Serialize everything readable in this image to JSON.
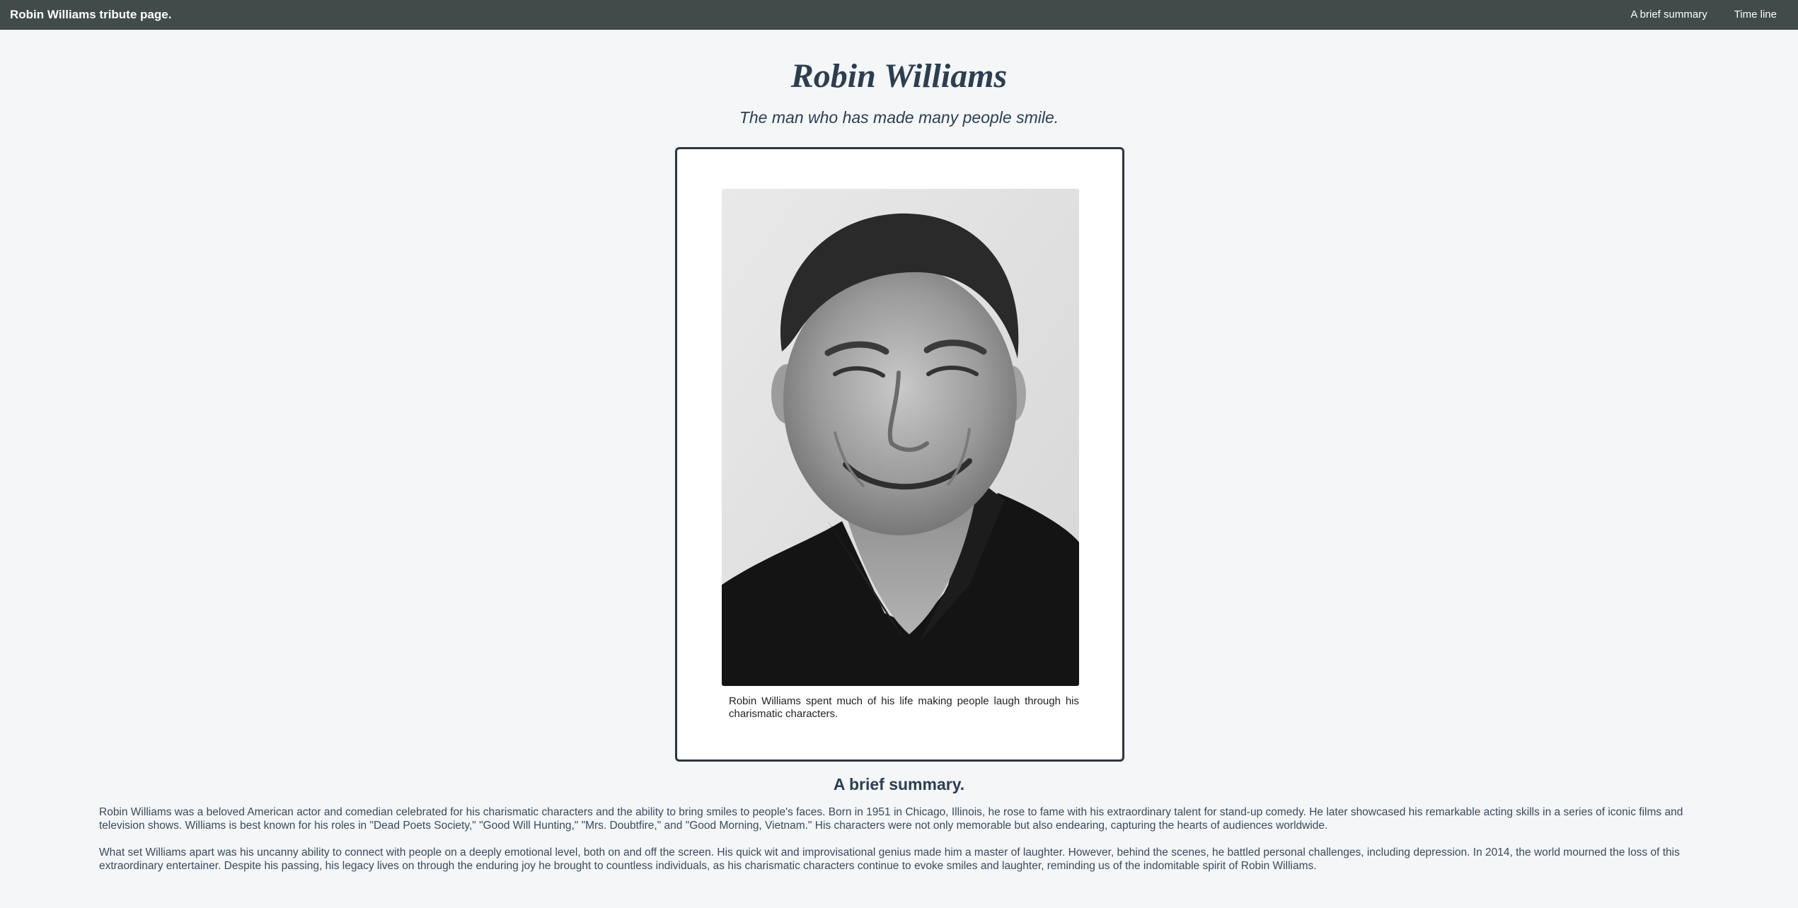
{
  "navbar": {
    "brand": "Robin Williams tribute page.",
    "links": [
      {
        "label": "A brief summary"
      },
      {
        "label": "Time line"
      }
    ]
  },
  "header": {
    "title": "Robin Williams",
    "subtitle": "The man who has made many people smile."
  },
  "figure": {
    "image": "black-and-white portrait photo",
    "caption": "Robin Williams spent much of his life making people laugh through his charismatic characters."
  },
  "summary": {
    "heading": "A brief summary.",
    "paragraphs": [
      "Robin Williams was a beloved American actor and comedian celebrated for his charismatic characters and the ability to bring smiles to people's faces. Born in 1951 in Chicago, Illinois, he rose to fame with his extraordinary talent for stand-up comedy. He later showcased his remarkable acting skills in a series of iconic films and television shows. Williams is best known for his roles in \"Dead Poets Society,\" \"Good Will Hunting,\" \"Mrs. Doubtfire,\" and \"Good Morning, Vietnam.\" His characters were not only memorable but also endearing, capturing the hearts of audiences worldwide.",
      "What set Williams apart was his uncanny ability to connect with people on a deeply emotional level, both on and off the screen. His quick wit and improvisational genius made him a master of laughter. However, behind the scenes, he battled personal challenges, including depression. In 2014, the world mourned the loss of this extraordinary entertainer. Despite his passing, his legacy lives on through the enduring joy he brought to countless individuals, as his charismatic characters continue to evoke smiles and laughter, reminding us of the indomitable spirit of Robin Williams."
    ]
  },
  "colors": {
    "navbar": "#404b4a",
    "background": "#f4f6f8",
    "heading_text": "#2c3e50",
    "card_border": "#2c3540"
  }
}
